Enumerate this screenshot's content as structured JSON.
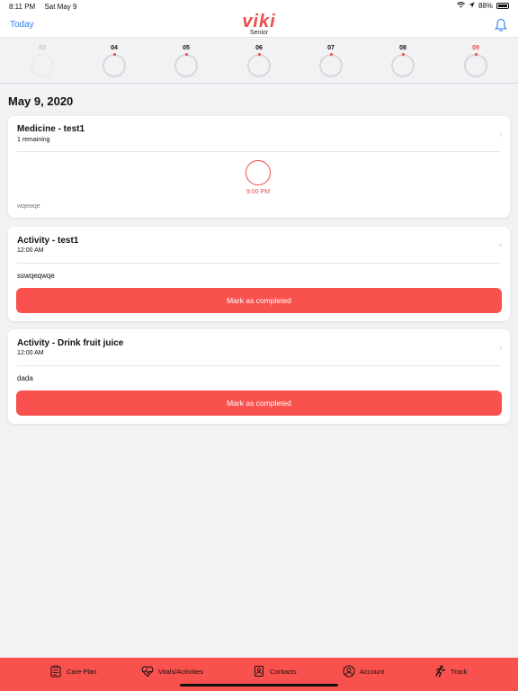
{
  "status_bar": {
    "time": "8:11 PM",
    "date": "Sat May 9",
    "battery": "88%"
  },
  "nav": {
    "today_label": "Today",
    "logo_word": "viki",
    "logo_sub": "Senior"
  },
  "week": [
    {
      "num": "03",
      "state": "past"
    },
    {
      "num": "04",
      "state": "normal"
    },
    {
      "num": "05",
      "state": "normal"
    },
    {
      "num": "06",
      "state": "normal"
    },
    {
      "num": "07",
      "state": "normal"
    },
    {
      "num": "08",
      "state": "normal"
    },
    {
      "num": "09",
      "state": "today"
    }
  ],
  "date_heading": "May 9, 2020",
  "cards": {
    "medicine": {
      "title": "Medicine - test1",
      "subtitle": "1 remaining",
      "dose_time": "9:00 PM",
      "note": "wqewqe"
    },
    "activity1": {
      "title": "Activity - test1",
      "subtitle": "12:00 AM",
      "note": "sswqeqwqe",
      "button": "Mark as completed"
    },
    "activity2": {
      "title": "Activity - Drink fruit juice",
      "subtitle": "12:00 AM",
      "note": "dada",
      "button": "Mark as completed"
    }
  },
  "tabs": {
    "care_plan": "Care Plan",
    "vitals": "Vitals/Activities",
    "contacts": "Contacts",
    "account": "Account",
    "track": "Track"
  },
  "colors": {
    "accent": "#f9514d",
    "link": "#2f7ef2",
    "logo": "#ee4b4b"
  }
}
